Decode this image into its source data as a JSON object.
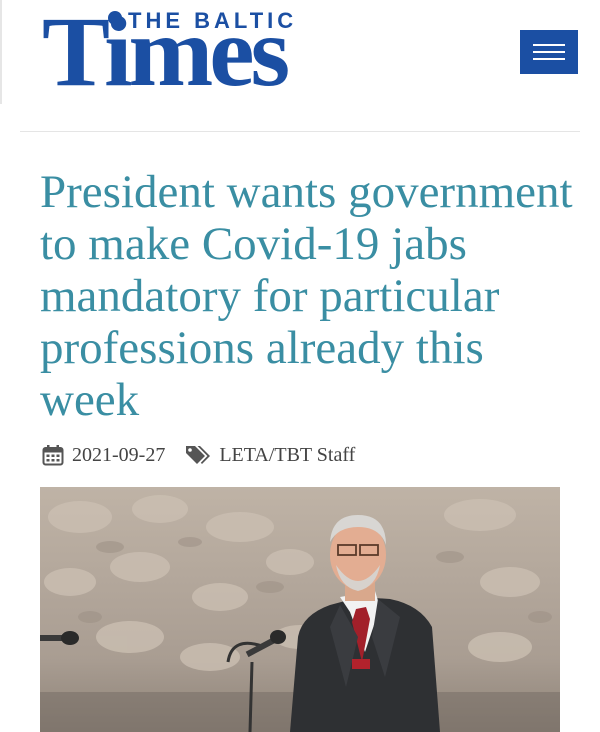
{
  "brand": {
    "top_line": "THE BALTIC",
    "wordmark": "Times",
    "color": "#1b4fa3"
  },
  "header": {
    "menu_icon": "hamburger-icon"
  },
  "article": {
    "headline": "President wants government to make Covid-19 jabs mandatory for particular professions already this week",
    "headline_color": "#3a8ea3",
    "date": "2021-09-27",
    "date_icon": "calendar-icon",
    "author": "LETA/TBT Staff",
    "author_icon": "tags-icon"
  }
}
